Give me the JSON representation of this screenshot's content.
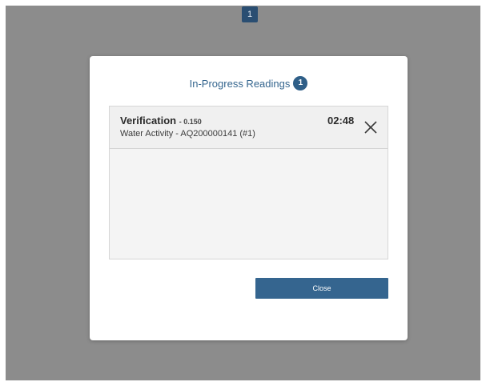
{
  "page_indicator": "1",
  "modal": {
    "title": "In-Progress Readings",
    "count": "1",
    "readings": [
      {
        "type": "Verification",
        "value": "- 0.150",
        "description": "Water Activity - AQ200000141 (#1)",
        "timer": "02:48",
        "dismiss_icon": "close-icon"
      }
    ],
    "close_label": "Close"
  },
  "colors": {
    "overlay": "#8c8c8c",
    "accent": "#35658f",
    "badge": "#2f5f88"
  }
}
